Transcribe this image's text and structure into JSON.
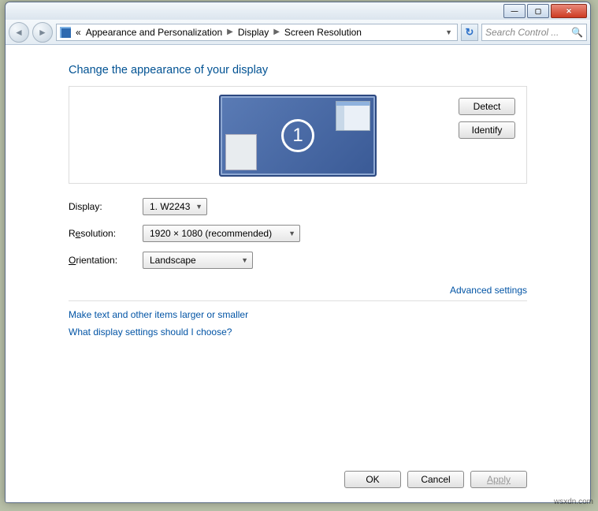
{
  "titlebar": {
    "min": "—",
    "max": "▢",
    "close": "✕"
  },
  "nav": {
    "crumb_prefix": "«",
    "crumb1": "Appearance and Personalization",
    "crumb2": "Display",
    "crumb3": "Screen Resolution",
    "search_placeholder": "Search Control ..."
  },
  "page": {
    "heading": "Change the appearance of your display",
    "monitor_number": "1",
    "detect": "Detect",
    "identify": "Identify",
    "display_label": "Display:",
    "display_value": "1. W2243",
    "resolution_label_pre": "R",
    "resolution_label_u": "e",
    "resolution_label_post": "solution:",
    "resolution_value": "1920 × 1080 (recommended)",
    "orientation_label_pre": "",
    "orientation_label_u": "O",
    "orientation_label_post": "rientation:",
    "orientation_value": "Landscape",
    "advanced": "Advanced settings",
    "link1": "Make text and other items larger or smaller",
    "link2": "What display settings should I choose?",
    "ok": "OK",
    "cancel": "Cancel",
    "apply": "Apply"
  },
  "watermark": "wsxdn.com"
}
